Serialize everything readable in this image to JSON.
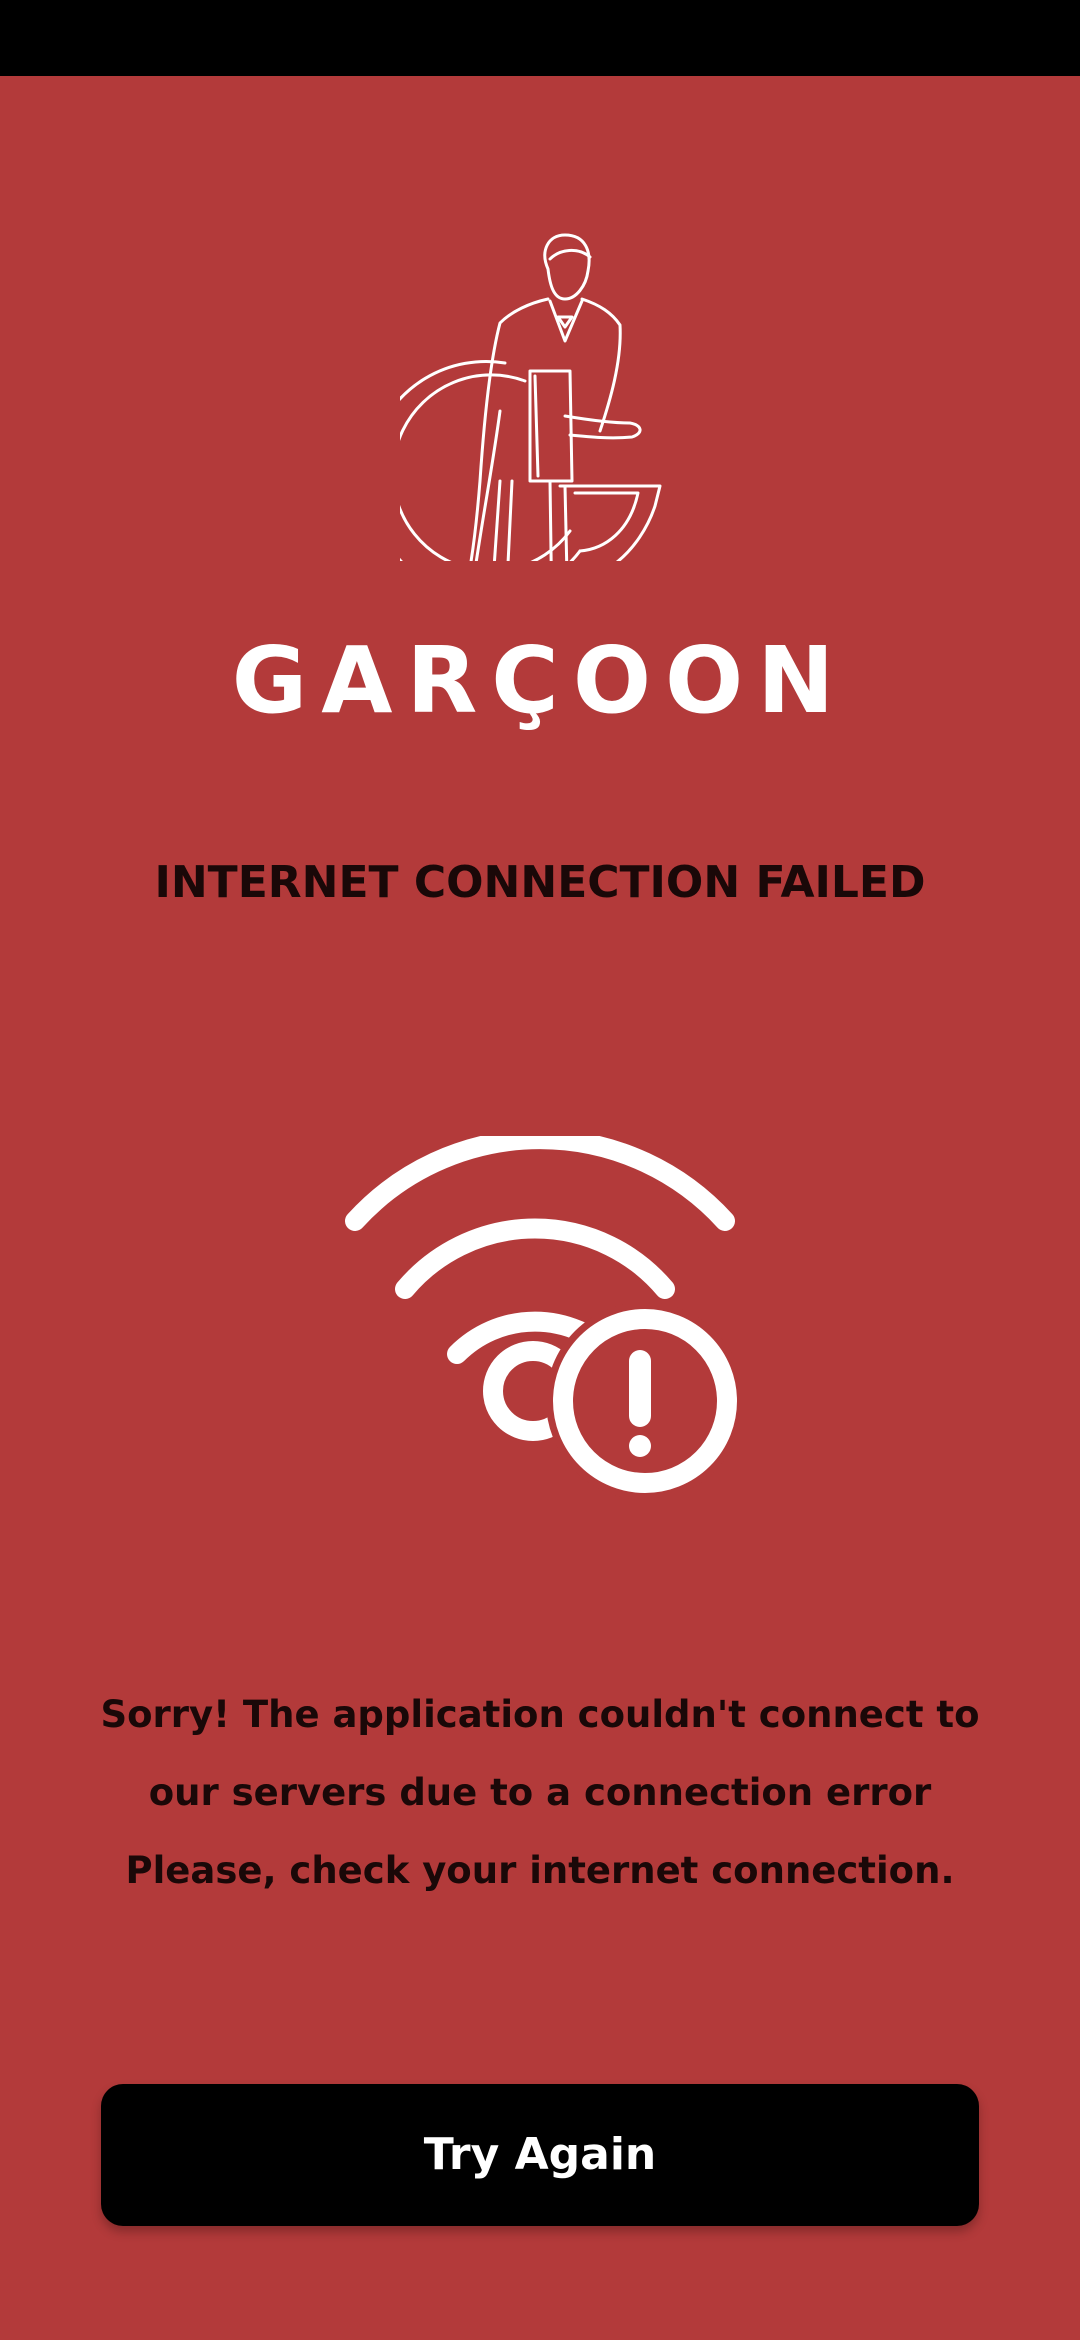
{
  "brand": {
    "name": "GARÇOON",
    "logo_icon": "waiter-logo-icon"
  },
  "error": {
    "title": "INTERNET CONNECTION FAILED",
    "icon": "wifi-error-icon",
    "message_lines": [
      "Sorry! The application couldn't connect to",
      "our servers due to a connection error",
      "Please, check your internet connection."
    ]
  },
  "actions": {
    "try_again_label": "Try Again"
  },
  "colors": {
    "background": "#b33a3a",
    "status_bar": "#000000",
    "button": "#000000",
    "button_text": "#ffffff",
    "text": "#1a0808",
    "icon": "#ffffff"
  }
}
